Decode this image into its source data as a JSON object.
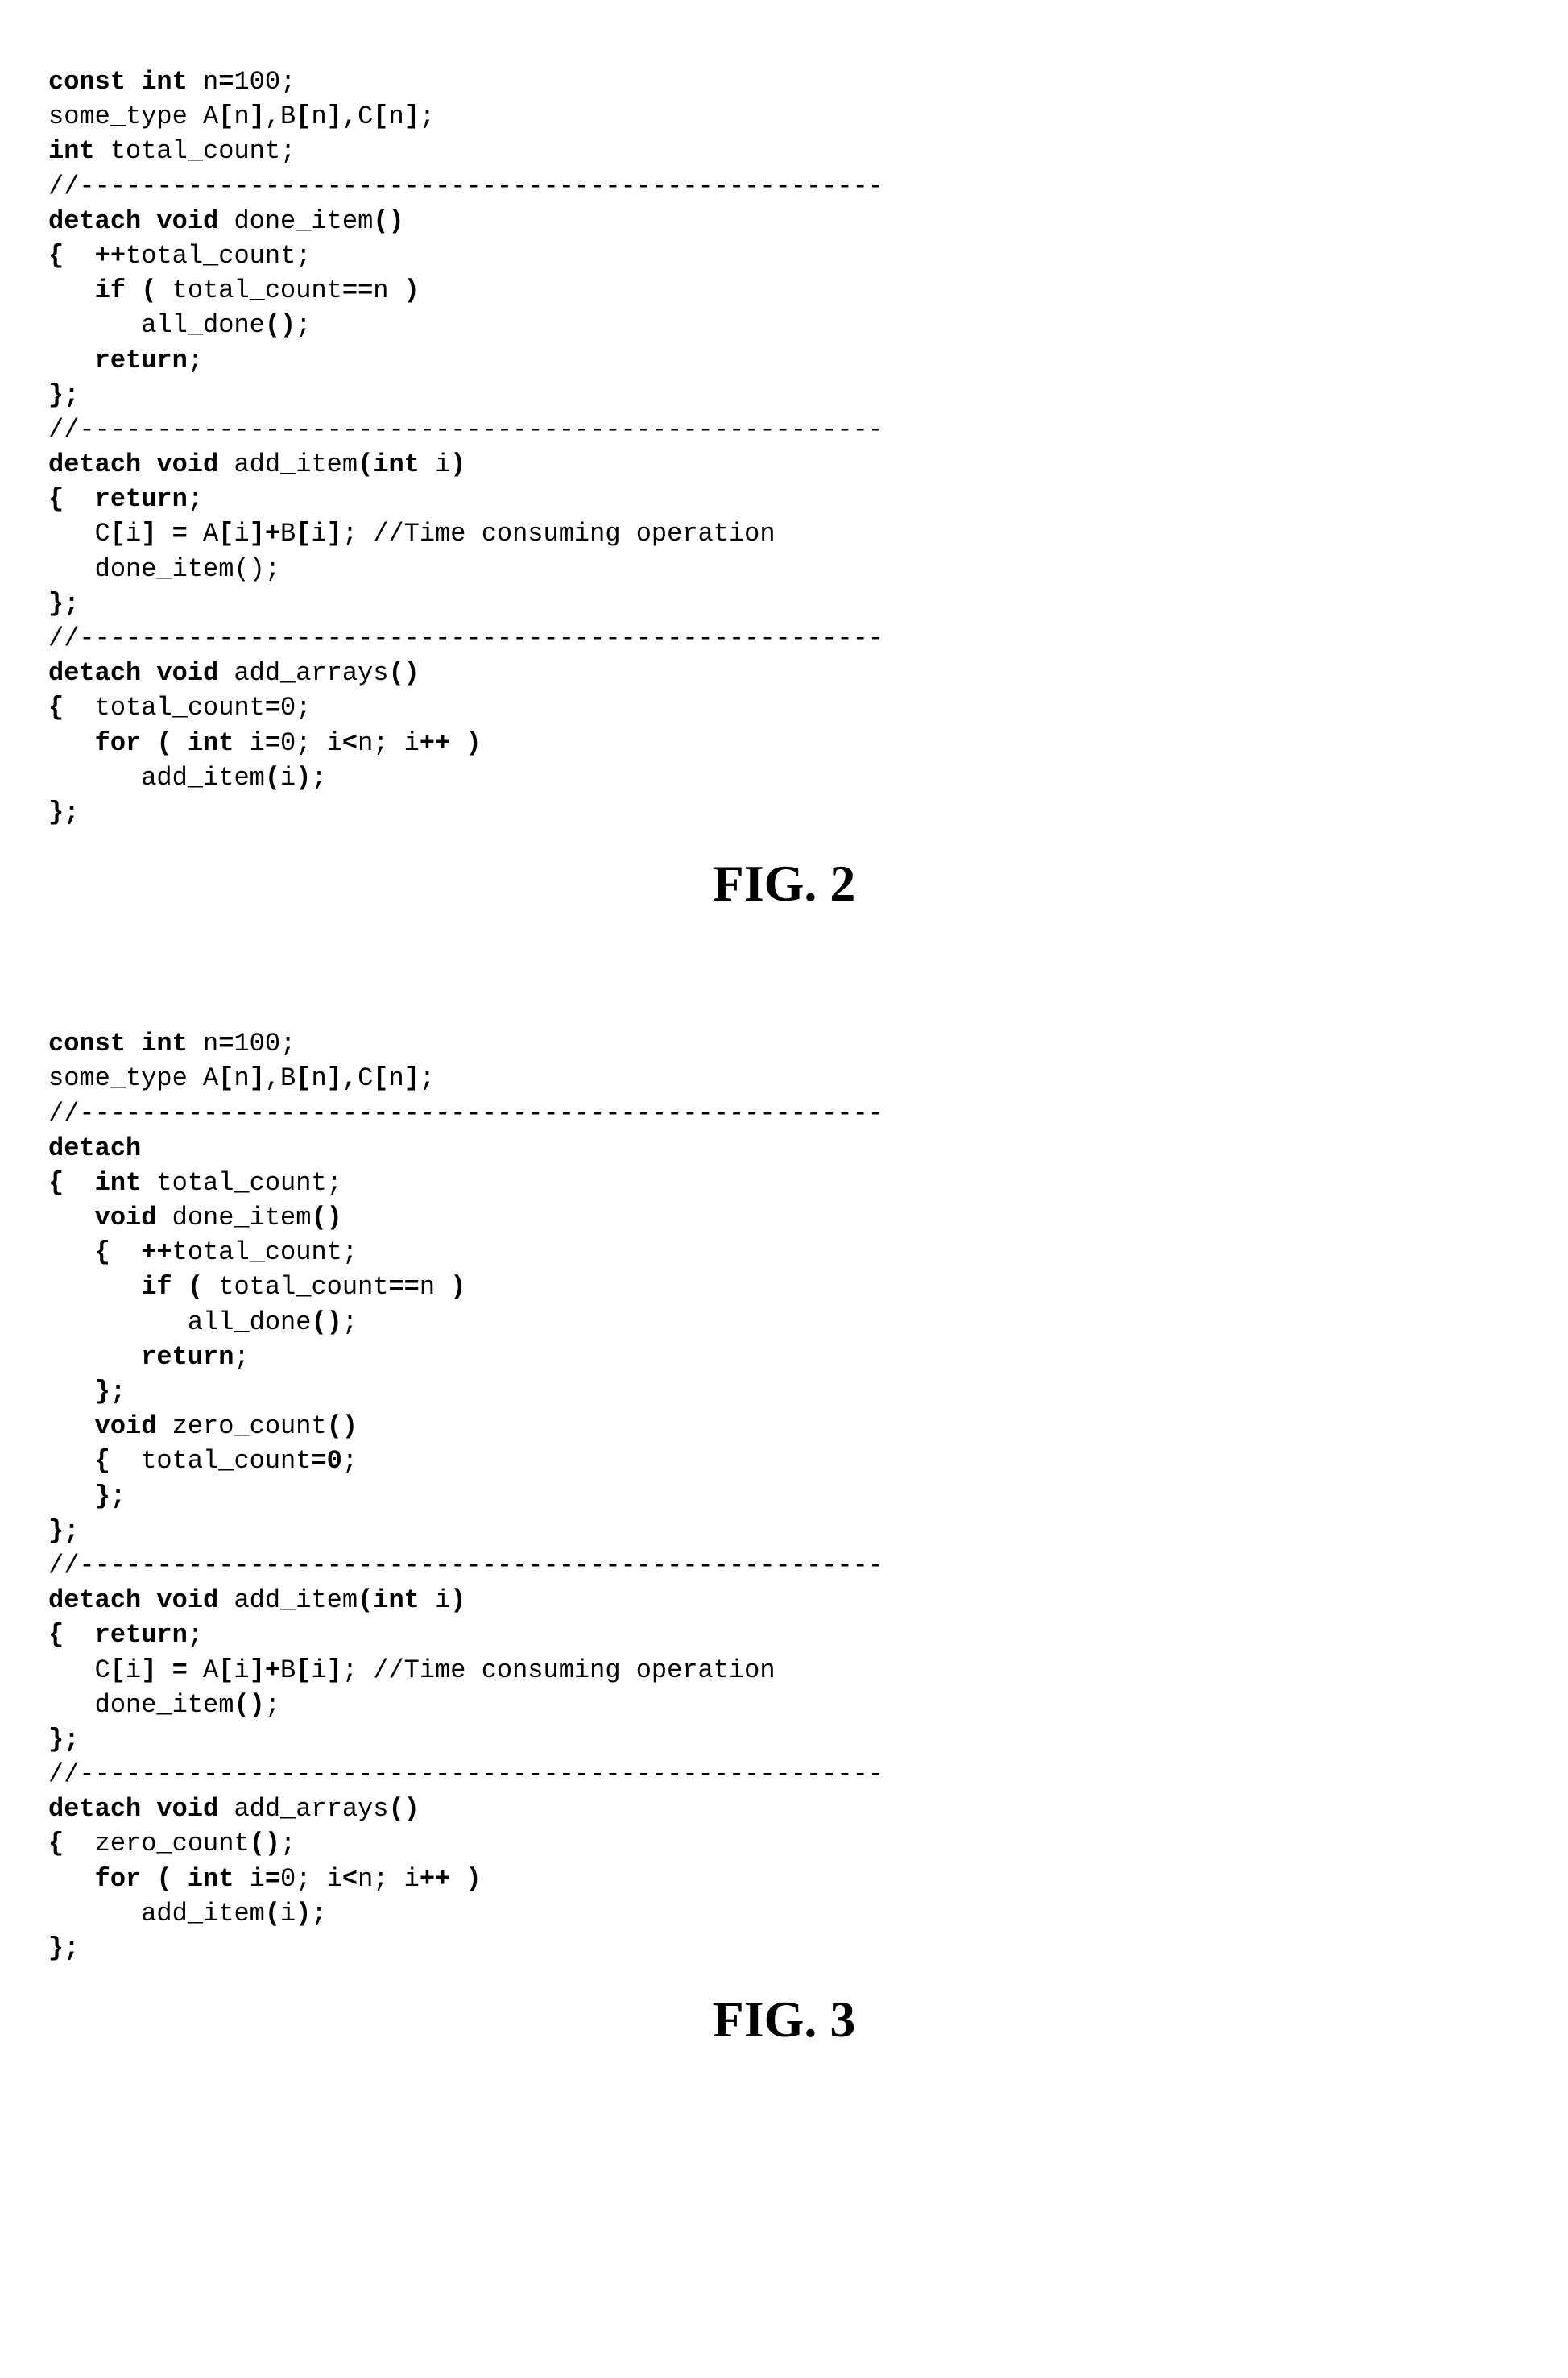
{
  "fig2": {
    "caption": "FIG. 2",
    "lines": [
      [
        {
          "t": "const int",
          "b": true
        },
        {
          "t": " n",
          "b": false
        },
        {
          "t": "=",
          "b": true
        },
        {
          "t": "100;",
          "b": false
        }
      ],
      [
        {
          "t": "some_type A",
          "b": false
        },
        {
          "t": "[",
          "b": true
        },
        {
          "t": "n",
          "b": false
        },
        {
          "t": "]",
          "b": true
        },
        {
          "t": ",B",
          "b": false
        },
        {
          "t": "[",
          "b": true
        },
        {
          "t": "n",
          "b": false
        },
        {
          "t": "]",
          "b": true
        },
        {
          "t": ",C",
          "b": false
        },
        {
          "t": "[",
          "b": true
        },
        {
          "t": "n",
          "b": false
        },
        {
          "t": "]",
          "b": true
        },
        {
          "t": ";",
          "b": false
        }
      ],
      [
        {
          "t": "int",
          "b": true
        },
        {
          "t": " total_count;",
          "b": false
        }
      ],
      [
        {
          "t": "//----------------------------------------------------",
          "b": false
        }
      ],
      [
        {
          "t": "detach void",
          "b": true
        },
        {
          "t": " done_item",
          "b": false
        },
        {
          "t": "()",
          "b": true
        }
      ],
      [
        {
          "t": "{  ++",
          "b": true
        },
        {
          "t": "total_count;",
          "b": false
        }
      ],
      [
        {
          "t": "   ",
          "b": false
        },
        {
          "t": "if (",
          "b": true
        },
        {
          "t": " total_count",
          "b": false
        },
        {
          "t": "==",
          "b": true
        },
        {
          "t": "n ",
          "b": false
        },
        {
          "t": ")",
          "b": true
        }
      ],
      [
        {
          "t": "      all_done",
          "b": false
        },
        {
          "t": "()",
          "b": true
        },
        {
          "t": ";",
          "b": false
        }
      ],
      [
        {
          "t": "   ",
          "b": false
        },
        {
          "t": "return",
          "b": true
        },
        {
          "t": ";",
          "b": false
        }
      ],
      [
        {
          "t": "};",
          "b": true
        }
      ],
      [
        {
          "t": "//----------------------------------------------------",
          "b": false
        }
      ],
      [
        {
          "t": "detach void",
          "b": true
        },
        {
          "t": " add_item",
          "b": false
        },
        {
          "t": "(int",
          "b": true
        },
        {
          "t": " i",
          "b": false
        },
        {
          "t": ")",
          "b": true
        }
      ],
      [
        {
          "t": "{  return",
          "b": true
        },
        {
          "t": ";",
          "b": false
        }
      ],
      [
        {
          "t": "   C",
          "b": false
        },
        {
          "t": "[",
          "b": true
        },
        {
          "t": "i",
          "b": false
        },
        {
          "t": "] =",
          "b": true
        },
        {
          "t": " A",
          "b": false
        },
        {
          "t": "[",
          "b": true
        },
        {
          "t": "i",
          "b": false
        },
        {
          "t": "]+",
          "b": true
        },
        {
          "t": "B",
          "b": false
        },
        {
          "t": "[",
          "b": true
        },
        {
          "t": "i",
          "b": false
        },
        {
          "t": "]",
          "b": true
        },
        {
          "t": "; //Time consuming operation",
          "b": false
        }
      ],
      [
        {
          "t": "   done_item();",
          "b": false
        }
      ],
      [
        {
          "t": "};",
          "b": true
        }
      ],
      [
        {
          "t": "//----------------------------------------------------",
          "b": false
        }
      ],
      [
        {
          "t": "detach void",
          "b": true
        },
        {
          "t": " add_arrays",
          "b": false
        },
        {
          "t": "()",
          "b": true
        }
      ],
      [
        {
          "t": "{",
          "b": true
        },
        {
          "t": "  total_count",
          "b": false
        },
        {
          "t": "=",
          "b": true
        },
        {
          "t": "0;",
          "b": false
        }
      ],
      [
        {
          "t": "   ",
          "b": false
        },
        {
          "t": "for ( int",
          "b": true
        },
        {
          "t": " i",
          "b": false
        },
        {
          "t": "=",
          "b": true
        },
        {
          "t": "0; i",
          "b": false
        },
        {
          "t": "<",
          "b": true
        },
        {
          "t": "n; i",
          "b": false
        },
        {
          "t": "++ )",
          "b": true
        }
      ],
      [
        {
          "t": "      add_item",
          "b": false
        },
        {
          "t": "(",
          "b": true
        },
        {
          "t": "i",
          "b": false
        },
        {
          "t": ")",
          "b": true
        },
        {
          "t": ";",
          "b": false
        }
      ],
      [
        {
          "t": "};",
          "b": true
        }
      ]
    ]
  },
  "fig3": {
    "caption": "FIG. 3",
    "lines": [
      [
        {
          "t": "const int",
          "b": true
        },
        {
          "t": " n",
          "b": false
        },
        {
          "t": "=",
          "b": true
        },
        {
          "t": "100;",
          "b": false
        }
      ],
      [
        {
          "t": "some_type A",
          "b": false
        },
        {
          "t": "[",
          "b": true
        },
        {
          "t": "n",
          "b": false
        },
        {
          "t": "]",
          "b": true
        },
        {
          "t": ",B",
          "b": false
        },
        {
          "t": "[",
          "b": true
        },
        {
          "t": "n",
          "b": false
        },
        {
          "t": "]",
          "b": true
        },
        {
          "t": ",C",
          "b": false
        },
        {
          "t": "[",
          "b": true
        },
        {
          "t": "n",
          "b": false
        },
        {
          "t": "]",
          "b": true
        },
        {
          "t": ";",
          "b": false
        }
      ],
      [
        {
          "t": "//----------------------------------------------------",
          "b": false
        }
      ],
      [
        {
          "t": "detach",
          "b": true
        }
      ],
      [
        {
          "t": "{  int",
          "b": true
        },
        {
          "t": " total_count;",
          "b": false
        }
      ],
      [
        {
          "t": "   ",
          "b": false
        },
        {
          "t": "void",
          "b": true
        },
        {
          "t": " done_item",
          "b": false
        },
        {
          "t": "()",
          "b": true
        }
      ],
      [
        {
          "t": "   ",
          "b": false
        },
        {
          "t": "{  ++",
          "b": true
        },
        {
          "t": "total_count;",
          "b": false
        }
      ],
      [
        {
          "t": "      ",
          "b": false
        },
        {
          "t": "if (",
          "b": true
        },
        {
          "t": " total_count",
          "b": false
        },
        {
          "t": "==",
          "b": true
        },
        {
          "t": "n ",
          "b": false
        },
        {
          "t": ")",
          "b": true
        }
      ],
      [
        {
          "t": "         all_done",
          "b": false
        },
        {
          "t": "()",
          "b": true
        },
        {
          "t": ";",
          "b": false
        }
      ],
      [
        {
          "t": "      ",
          "b": false
        },
        {
          "t": "return",
          "b": true
        },
        {
          "t": ";",
          "b": false
        }
      ],
      [
        {
          "t": "   ",
          "b": false
        },
        {
          "t": "};",
          "b": true
        }
      ],
      [
        {
          "t": "   ",
          "b": false
        },
        {
          "t": "void",
          "b": true
        },
        {
          "t": " zero_count",
          "b": false
        },
        {
          "t": "()",
          "b": true
        }
      ],
      [
        {
          "t": "   ",
          "b": false
        },
        {
          "t": "{",
          "b": true
        },
        {
          "t": "  total_count",
          "b": false
        },
        {
          "t": "=0",
          "b": true
        },
        {
          "t": ";",
          "b": false
        }
      ],
      [
        {
          "t": "   ",
          "b": false
        },
        {
          "t": "};",
          "b": true
        }
      ],
      [
        {
          "t": "};",
          "b": true
        }
      ],
      [
        {
          "t": "//----------------------------------------------------",
          "b": false
        }
      ],
      [
        {
          "t": "detach void",
          "b": true
        },
        {
          "t": " add_item",
          "b": false
        },
        {
          "t": "(int",
          "b": true
        },
        {
          "t": " i",
          "b": false
        },
        {
          "t": ")",
          "b": true
        }
      ],
      [
        {
          "t": "{  return",
          "b": true
        },
        {
          "t": ";",
          "b": false
        }
      ],
      [
        {
          "t": "   C",
          "b": false
        },
        {
          "t": "[",
          "b": true
        },
        {
          "t": "i",
          "b": false
        },
        {
          "t": "] =",
          "b": true
        },
        {
          "t": " A",
          "b": false
        },
        {
          "t": "[",
          "b": true
        },
        {
          "t": "i",
          "b": false
        },
        {
          "t": "]+",
          "b": true
        },
        {
          "t": "B",
          "b": false
        },
        {
          "t": "[",
          "b": true
        },
        {
          "t": "i",
          "b": false
        },
        {
          "t": "]",
          "b": true
        },
        {
          "t": "; //Time consuming operation",
          "b": false
        }
      ],
      [
        {
          "t": "   done_item",
          "b": false
        },
        {
          "t": "()",
          "b": true
        },
        {
          "t": ";",
          "b": false
        }
      ],
      [
        {
          "t": "};",
          "b": true
        }
      ],
      [
        {
          "t": "//----------------------------------------------------",
          "b": false
        }
      ],
      [
        {
          "t": "detach void",
          "b": true
        },
        {
          "t": " add_arrays",
          "b": false
        },
        {
          "t": "()",
          "b": true
        }
      ],
      [
        {
          "t": "{",
          "b": true
        },
        {
          "t": "  zero_count",
          "b": false
        },
        {
          "t": "()",
          "b": true
        },
        {
          "t": ";",
          "b": false
        }
      ],
      [
        {
          "t": "   ",
          "b": false
        },
        {
          "t": "for ( int",
          "b": true
        },
        {
          "t": " i",
          "b": false
        },
        {
          "t": "=",
          "b": true
        },
        {
          "t": "0; i",
          "b": false
        },
        {
          "t": "<",
          "b": true
        },
        {
          "t": "n; i",
          "b": false
        },
        {
          "t": "++ )",
          "b": true
        }
      ],
      [
        {
          "t": "      add_item",
          "b": false
        },
        {
          "t": "(",
          "b": true
        },
        {
          "t": "i",
          "b": false
        },
        {
          "t": ")",
          "b": true
        },
        {
          "t": ";",
          "b": false
        }
      ],
      [
        {
          "t": "};",
          "b": true
        }
      ]
    ]
  }
}
